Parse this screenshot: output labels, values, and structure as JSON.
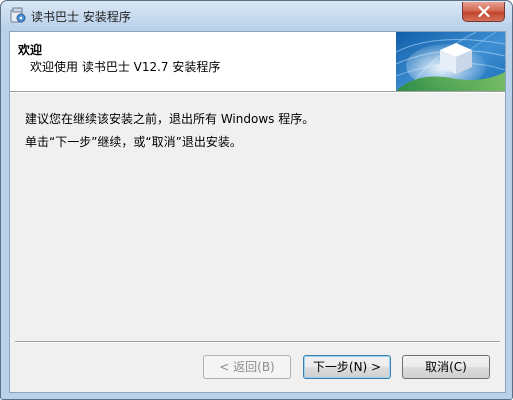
{
  "window": {
    "title": "读书巴士 安装程序",
    "close_glyph": "✕"
  },
  "header": {
    "title": "欢迎",
    "subtitle": "欢迎使用 读书巴士 V12.7 安装程序"
  },
  "body": {
    "line1": "建议您在继续该安装之前，退出所有 Windows 程序。",
    "line2": "单击“下一步”继续，或“取消”退出安装。"
  },
  "buttons": {
    "back": "< 返回(B)",
    "next": "下一步(N) >",
    "cancel": "取消(C)"
  },
  "colors": {
    "titlebar": "#c9dcf0",
    "close_button": "#c2452c",
    "dialog_background": "#f0f0f0",
    "banner_background": "#ffffff"
  }
}
